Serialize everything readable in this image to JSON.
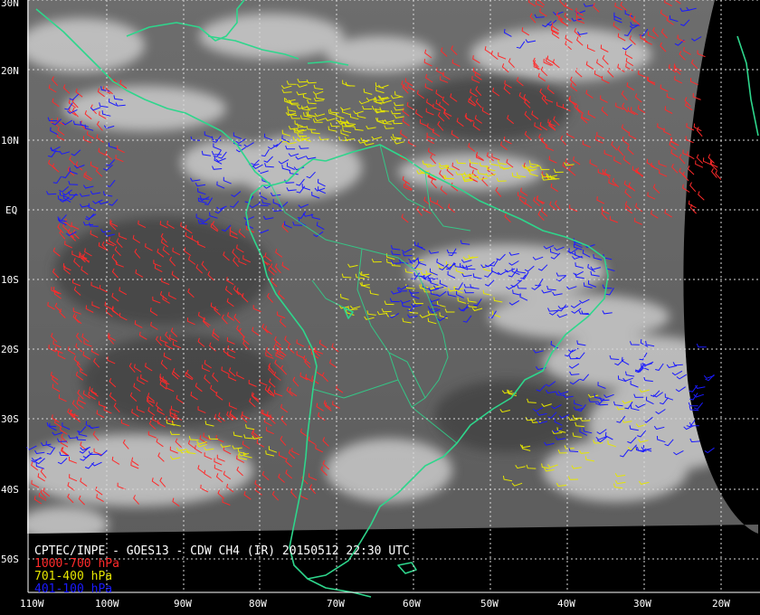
{
  "title": "CPTEC/INPE - GOES13 - CDW CH4 (IR) 20150512 22:30 UTC",
  "latitude_labels": [
    "30N",
    "20N",
    "10N",
    "EQ",
    "10S",
    "20S",
    "30S",
    "40S",
    "50S"
  ],
  "longitude_labels": [
    "110W",
    "100W",
    "90W",
    "80W",
    "70W",
    "60W",
    "50W",
    "40W",
    "30W",
    "20W"
  ],
  "legend": [
    {
      "label": "1000-700 hPa",
      "color": "#ff2a2a"
    },
    {
      "label": "701-400 hPa",
      "color": "#e6e600"
    },
    {
      "label": "401-100 hPa",
      "color": "#1a1aff"
    }
  ],
  "colors": {
    "coastline": "#2ed68c",
    "grid": "#d8d8d8",
    "background": "#000000",
    "label": "#ffffff"
  }
}
